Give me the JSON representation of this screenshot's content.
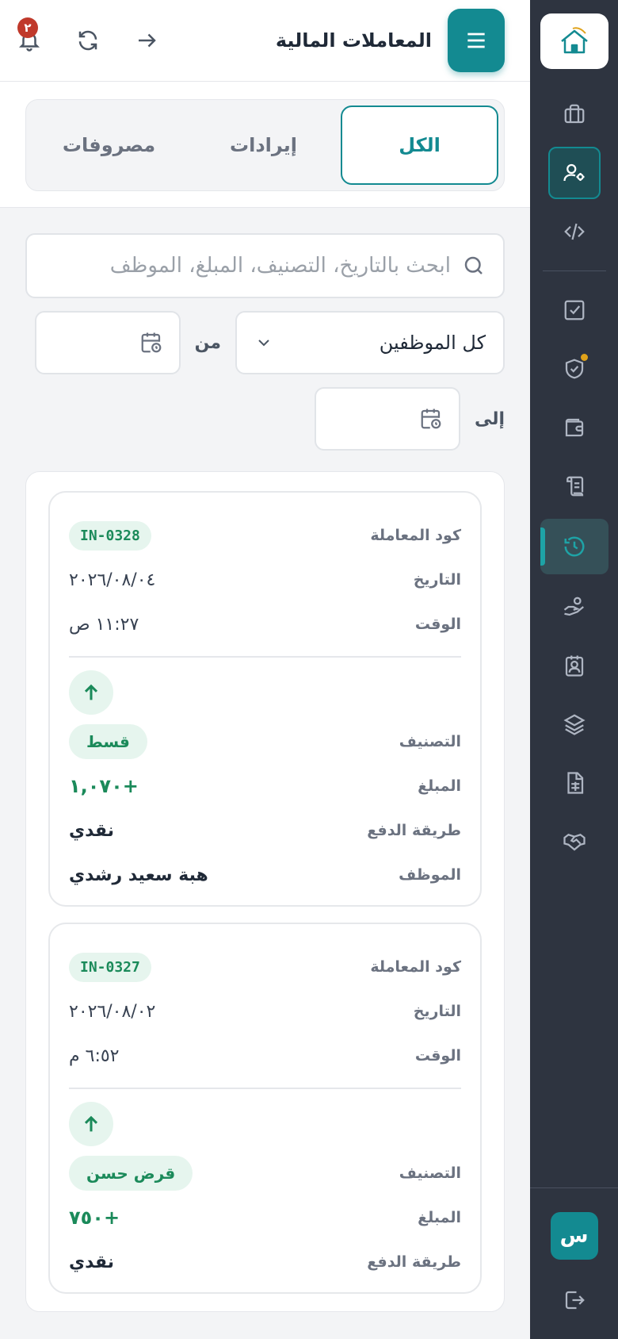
{
  "header": {
    "title": "المعاملات المالية",
    "notification_count": "٢"
  },
  "tabs": [
    {
      "label": "الكل",
      "active": true
    },
    {
      "label": "إيرادات",
      "active": false
    },
    {
      "label": "مصروفات",
      "active": false
    }
  ],
  "filters": {
    "search_placeholder": "ابحث بالتاريخ، التصنيف، المبلغ، الموظف",
    "employee_select": "كل الموظفين",
    "from_label": "من",
    "to_label": "إلى"
  },
  "labels": {
    "code": "كود المعاملة",
    "date": "التاريخ",
    "time": "الوقت",
    "category": "التصنيف",
    "amount": "المبلغ",
    "payment": "طريقة الدفع",
    "employee": "الموظف"
  },
  "transactions": [
    {
      "code": "IN-0328",
      "date": "٢٠٢٦/٠٨/٠٤",
      "time": "١١:٢٧ ص",
      "category": "قسط",
      "amount": "+١,٠٧٠",
      "payment": "نقدي",
      "employee": "هبة سعيد رشدي"
    },
    {
      "code": "IN-0327",
      "date": "٢٠٢٦/٠٨/٠٢",
      "time": "٦:٥٢ م",
      "category": "قرض حسن",
      "amount": "+٧٥٠",
      "payment": "نقدي"
    }
  ],
  "user": {
    "avatar_letter": "س"
  },
  "colors": {
    "accent": "#138a91",
    "sidebar": "#2e3440",
    "income_green": "#1b8a5a",
    "badge_red": "#c0392b"
  }
}
